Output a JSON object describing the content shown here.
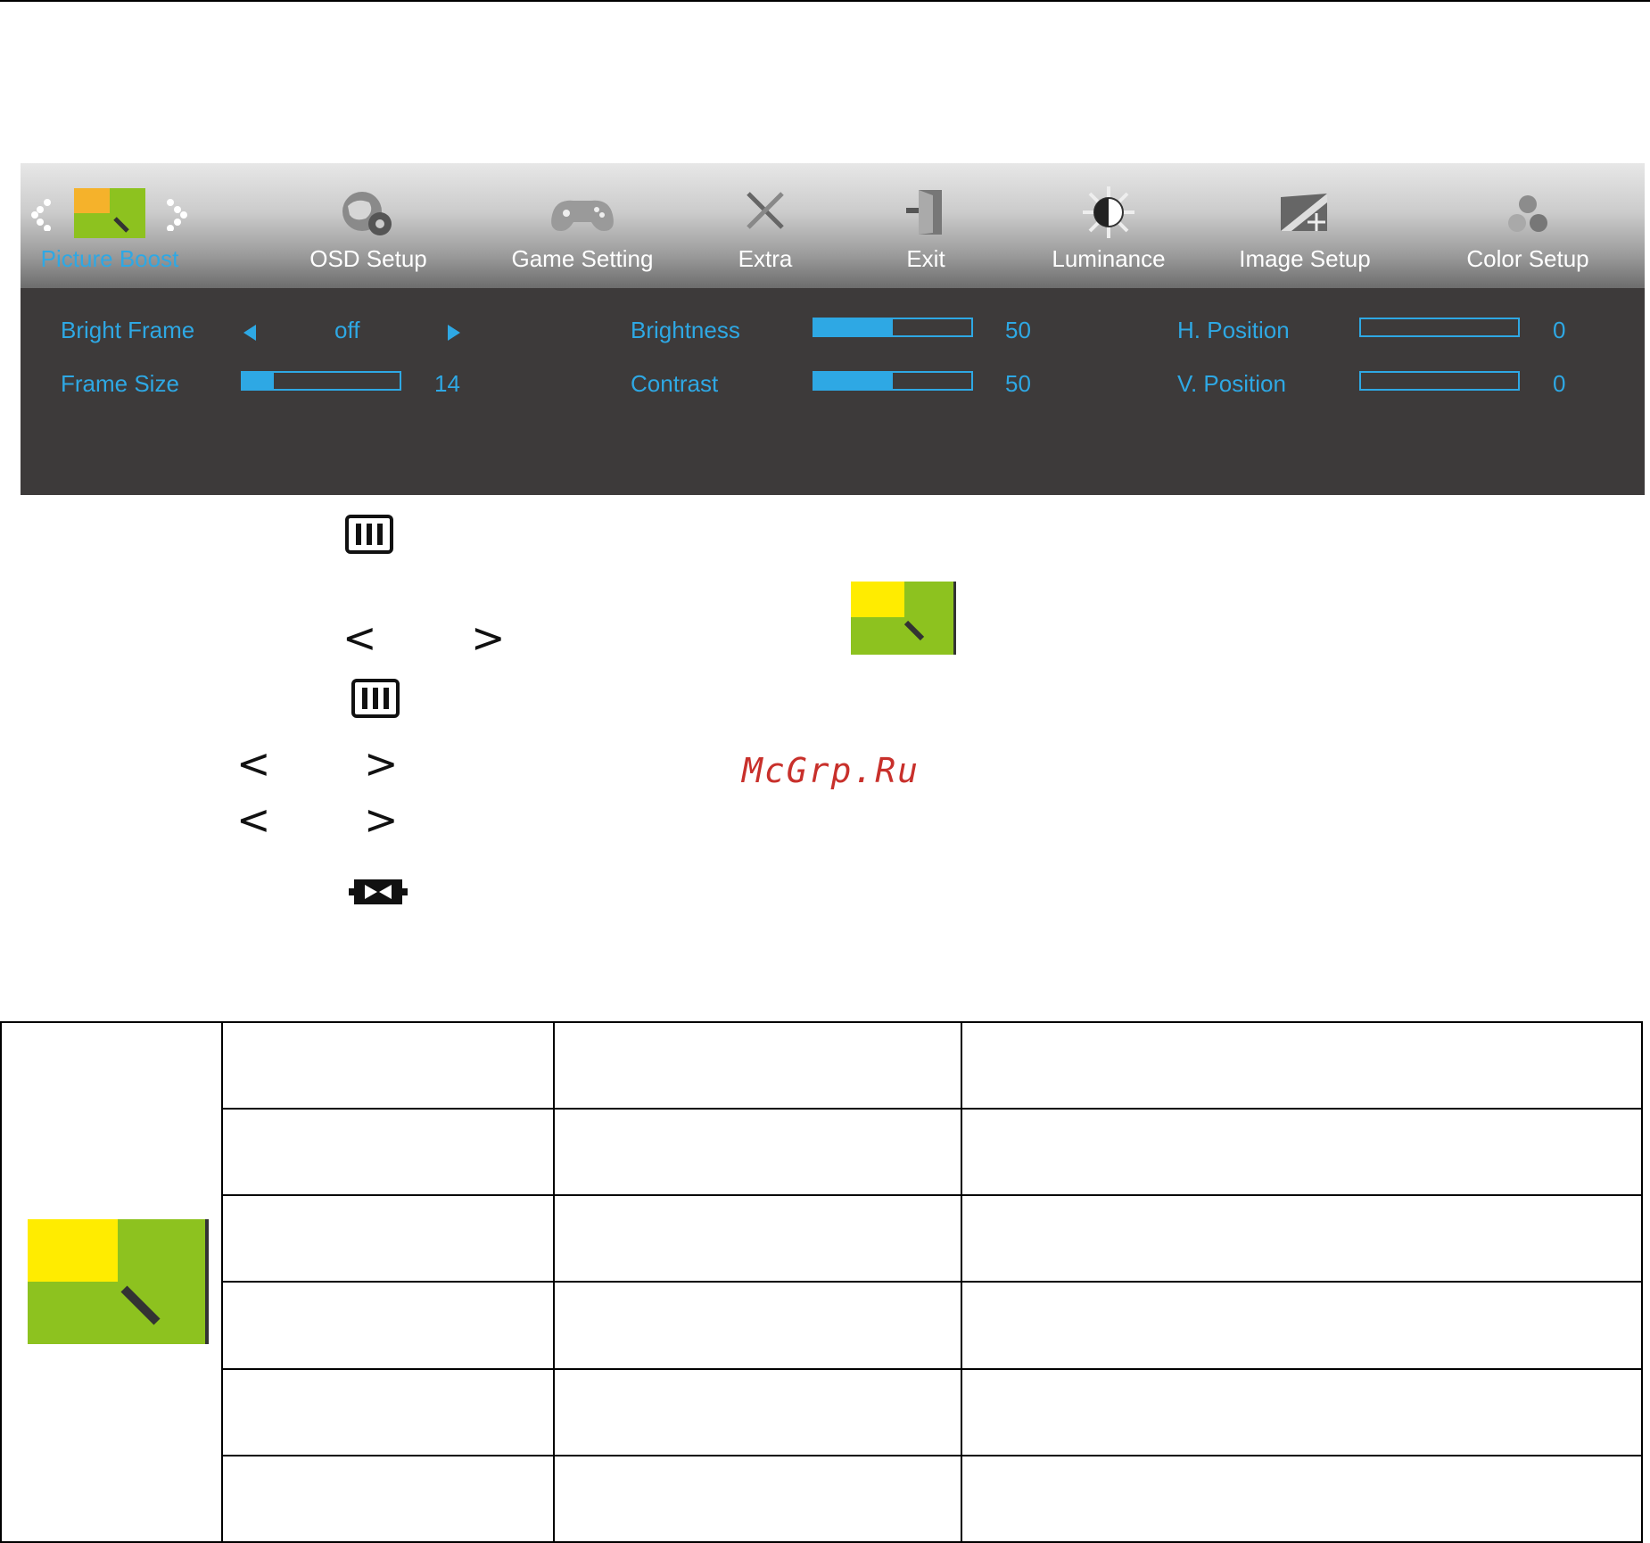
{
  "osd": {
    "tabs": [
      {
        "label": "Picture Boost",
        "icon": "picture-boost-icon",
        "active": true
      },
      {
        "label": "OSD Setup",
        "icon": "osd-setup-icon"
      },
      {
        "label": "Game Setting",
        "icon": "game-setting-icon"
      },
      {
        "label": "Extra",
        "icon": "extra-icon"
      },
      {
        "label": "Exit",
        "icon": "exit-icon"
      },
      {
        "label": "Luminance",
        "icon": "luminance-icon"
      },
      {
        "label": "Image Setup",
        "icon": "image-setup-icon"
      },
      {
        "label": "Color Setup",
        "icon": "color-setup-icon"
      }
    ],
    "bright_frame": {
      "label": "Bright Frame",
      "value": "off"
    },
    "frame_size": {
      "label": "Frame Size",
      "value": "14",
      "fraction": 0.2
    },
    "brightness": {
      "label": "Brightness",
      "value": "50",
      "fraction": 0.5
    },
    "contrast": {
      "label": "Contrast",
      "value": "50",
      "fraction": 0.5
    },
    "h_position": {
      "label": "H. Position",
      "value": "0",
      "fraction": 0
    },
    "v_position": {
      "label": "V. Position",
      "value": "0",
      "fraction": 0
    },
    "colors": {
      "accent": "#2ea8e4",
      "panel": "#3d3a3a",
      "green": "#8dc21f",
      "yellow": "#ffec00",
      "orange": "#f5b22b"
    }
  },
  "legend": {
    "icons": [
      "menu-key-icon",
      "left-arrow-icon",
      "right-arrow-icon",
      "menu-key-icon",
      "left-arrow-icon",
      "right-arrow-icon",
      "left-arrow-icon",
      "right-arrow-icon",
      "exit-key-icon"
    ]
  },
  "watermark": "McGrp.Ru"
}
